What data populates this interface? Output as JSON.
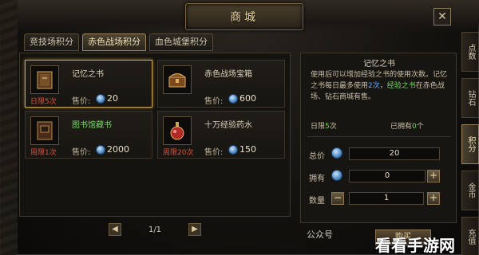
{
  "window": {
    "title": "商城",
    "close": "✕"
  },
  "tabs": [
    {
      "label": "竞技场积分"
    },
    {
      "label": "赤色战场积分"
    },
    {
      "label": "血色城堡积分"
    }
  ],
  "items": [
    {
      "name": "记忆之书",
      "limit": "日限5次",
      "price_label": "售价:",
      "price": "20"
    },
    {
      "name": "赤色战场宝箱",
      "limit": "",
      "price_label": "售价:",
      "price": "600"
    },
    {
      "name": "图书馆藏书",
      "limit": "周限1次",
      "price_label": "售价:",
      "price": "2000"
    },
    {
      "name": "十万经验药水",
      "limit": "周限20次",
      "price_label": "售价:",
      "price": "150"
    }
  ],
  "pager": {
    "prev": "◀",
    "text": "1/1",
    "next": "▶"
  },
  "detail": {
    "title": "记忆之书",
    "desc_1": "使用后可以增加经验之书的使用次数。记忆之书每日最多使用",
    "desc_hl": "2次",
    "desc_2": "，",
    "desc_g": "经验之书",
    "desc_3": "在赤色战场、钻石商城有售。",
    "daily_limit_label": "日限",
    "daily_limit_value": "5",
    "daily_limit_unit": "次",
    "owned_label": "已拥有",
    "owned_value": "0",
    "owned_unit": "个",
    "total_label": "总价",
    "total_value": "20",
    "have_label": "拥有",
    "have_value": "0",
    "qty_label": "数量",
    "qty_value": "1",
    "minus": "−",
    "plus": "+"
  },
  "buy_button": "购买",
  "side_tabs": [
    {
      "label": "点数"
    },
    {
      "label": "钻石"
    },
    {
      "label": "积分"
    },
    {
      "label": "金币"
    },
    {
      "label": "充值"
    }
  ],
  "watermark": {
    "left": "公众号",
    "right": "看看手游网"
  }
}
